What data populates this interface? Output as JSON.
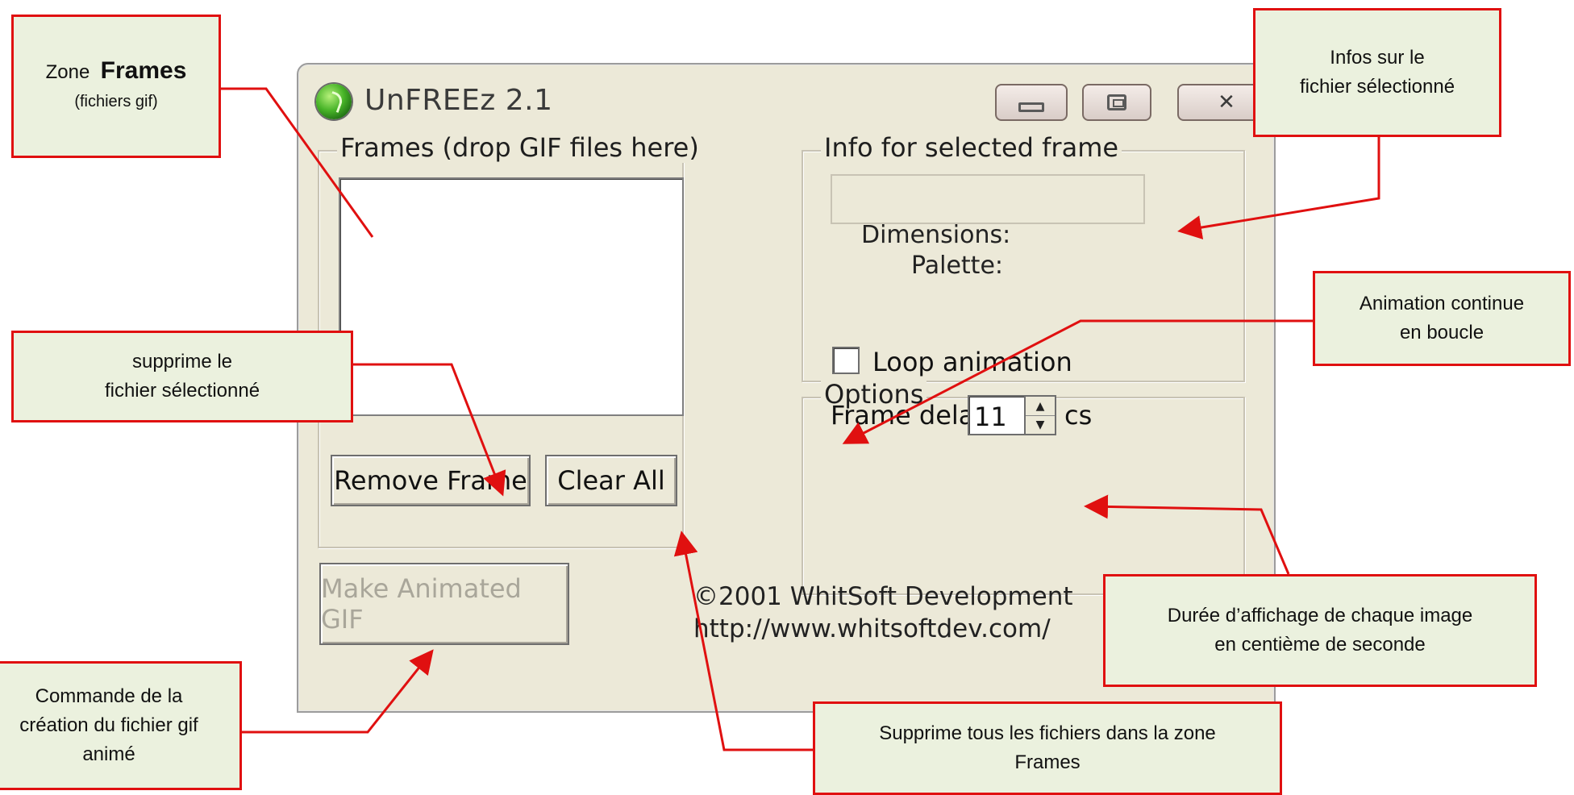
{
  "window": {
    "title": "UnFREEz 2.1",
    "frames_group_label": "Frames (drop GIF files here)",
    "info_group_label": "Info for selected frame",
    "dimensions_label": "Dimensions:",
    "palette_label": "Palette:",
    "options_group_label": "Options",
    "loop_label": "Loop animation",
    "loop_checked": false,
    "frame_delay_label": "Frame delay:",
    "frame_delay_value": "11",
    "frame_delay_unit": "cs",
    "remove_frame_label": "Remove Frame",
    "clear_all_label": "Clear All",
    "make_gif_label": "Make Animated GIF",
    "copyright_line1": "©2001 WhitSoft Development",
    "copyright_line2": "http://www.whitsoftdev.com/",
    "disabled_text_color": "#a9a69a"
  },
  "annotations": {
    "frames_zone": {
      "prefix": "Zone",
      "bold": "Frames",
      "sub": "(fichiers gif)"
    },
    "info_selected": {
      "line1": "Infos sur le",
      "line2": "fichier sélectionné"
    },
    "loop": {
      "line1": "Animation continue",
      "line2": "en boucle"
    },
    "remove": {
      "line1": "supprime le",
      "line2": "fichier sélectionné"
    },
    "duree": {
      "line1": "Durée d’affichage de chaque image",
      "line2": "en centième de seconde"
    },
    "make": {
      "line1": "Commande de la",
      "line2": "création du fichier gif",
      "line3": "animé"
    },
    "clear": {
      "line1": "Supprime tous les fichiers dans la zone",
      "line2": "Frames"
    },
    "callout_fill": "#ebf1de",
    "arrow_color": "#e01010"
  }
}
